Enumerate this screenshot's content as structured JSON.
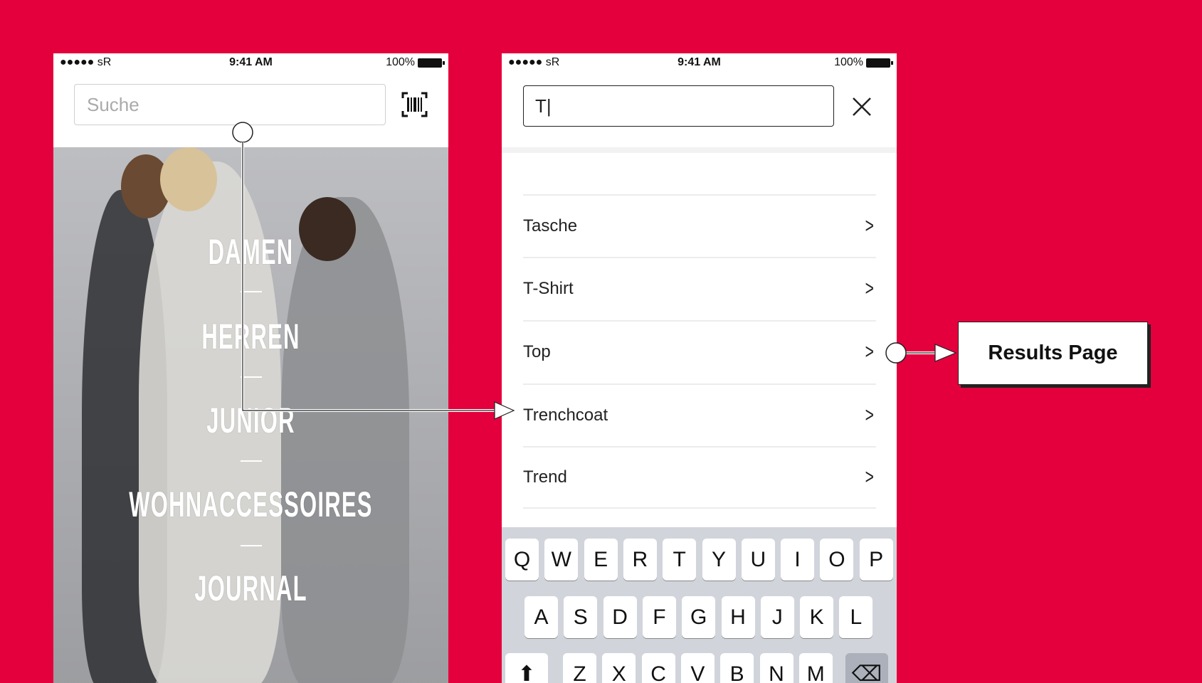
{
  "home_screen": {
    "status": {
      "carrier": "●●●●● sR",
      "time": "9:41 AM",
      "battery": "100%"
    },
    "search_placeholder": "Suche",
    "barcode_icon": "barcode-scanner-icon",
    "menu": [
      "DAMEN",
      "HERREN",
      "JUNIOR",
      "WOHNACCESSOIRES",
      "JOURNAL"
    ]
  },
  "search_screen": {
    "status": {
      "carrier": "●●●●● sR",
      "time": "9:41 AM",
      "battery": "100%"
    },
    "search_value": "T|",
    "close_icon": "close-x-icon",
    "suggestions": [
      "Tasche",
      "T-Shirt",
      "Top",
      "Trenchcoat",
      "Trend"
    ],
    "keyboard": {
      "row1": [
        "Q",
        "W",
        "E",
        "R",
        "T",
        "Y",
        "U",
        "I",
        "O",
        "P"
      ],
      "row2": [
        "A",
        "S",
        "D",
        "F",
        "G",
        "H",
        "J",
        "K",
        "L"
      ],
      "row3": [
        "Z",
        "X",
        "C",
        "V",
        "B",
        "N",
        "M"
      ],
      "shift": "⬆",
      "backspace": "⌫"
    }
  },
  "annotation": {
    "results_label": "Results Page"
  },
  "colors": {
    "background": "#e4003d"
  }
}
